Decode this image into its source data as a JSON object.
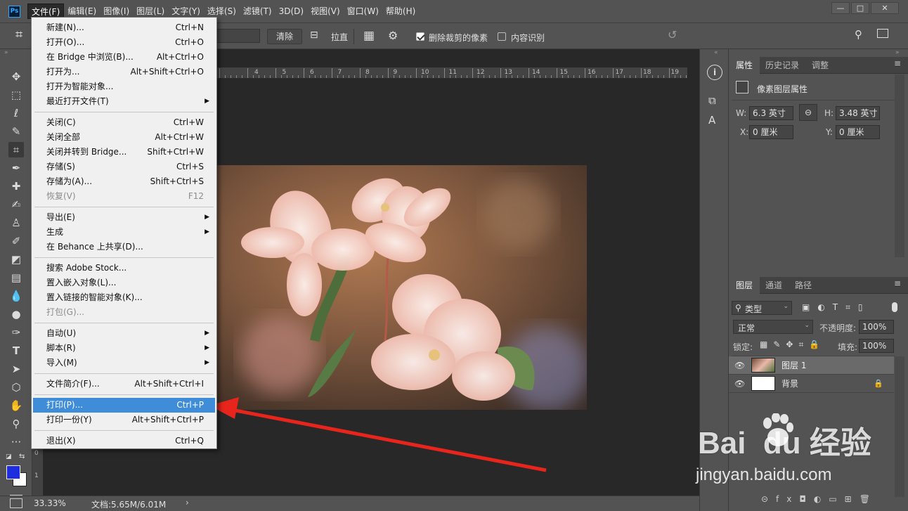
{
  "app_logo": "Ps",
  "menubar": {
    "items": [
      "文件(F)",
      "编辑(E)",
      "图像(I)",
      "图层(L)",
      "文字(Y)",
      "选择(S)",
      "滤镜(T)",
      "3D(D)",
      "视图(V)",
      "窗口(W)",
      "帮助(H)"
    ]
  },
  "window_controls": {
    "minimize": "—",
    "maximize": "□",
    "close": "✕"
  },
  "options_bar": {
    "clear_button": "清除",
    "straighten_label": "拉直",
    "delete_cropped_label": "删除裁剪的像素",
    "content_aware_label": "内容识别"
  },
  "ruler": {
    "h_ticks": [
      "4",
      "5",
      "6",
      "7",
      "8",
      "9",
      "10",
      "11",
      "12",
      "13",
      "14",
      "15",
      "16",
      "17",
      "18",
      "19"
    ],
    "v_ticks": [
      "0",
      "1"
    ]
  },
  "file_menu": {
    "groups": [
      [
        {
          "label": "新建(N)...",
          "shortcut": "Ctrl+N"
        },
        {
          "label": "打开(O)...",
          "shortcut": "Ctrl+O"
        },
        {
          "label": "在 Bridge 中浏览(B)...",
          "shortcut": "Alt+Ctrl+O"
        },
        {
          "label": "打开为...",
          "shortcut": "Alt+Shift+Ctrl+O"
        },
        {
          "label": "打开为智能对象...",
          "shortcut": ""
        },
        {
          "label": "最近打开文件(T)",
          "shortcut": "",
          "submenu": true
        }
      ],
      [
        {
          "label": "关闭(C)",
          "shortcut": "Ctrl+W"
        },
        {
          "label": "关闭全部",
          "shortcut": "Alt+Ctrl+W"
        },
        {
          "label": "关闭并转到 Bridge...",
          "shortcut": "Shift+Ctrl+W"
        },
        {
          "label": "存储(S)",
          "shortcut": "Ctrl+S"
        },
        {
          "label": "存储为(A)...",
          "shortcut": "Shift+Ctrl+S"
        },
        {
          "label": "恢复(V)",
          "shortcut": "F12",
          "disabled": true
        }
      ],
      [
        {
          "label": "导出(E)",
          "shortcut": "",
          "submenu": true
        },
        {
          "label": "生成",
          "shortcut": "",
          "submenu": true
        },
        {
          "label": "在 Behance 上共享(D)...",
          "shortcut": ""
        }
      ],
      [
        {
          "label": "搜索 Adobe Stock...",
          "shortcut": ""
        },
        {
          "label": "置入嵌入对象(L)...",
          "shortcut": ""
        },
        {
          "label": "置入链接的智能对象(K)...",
          "shortcut": ""
        },
        {
          "label": "打包(G)...",
          "shortcut": "",
          "disabled": true
        }
      ],
      [
        {
          "label": "自动(U)",
          "shortcut": "",
          "submenu": true
        },
        {
          "label": "脚本(R)",
          "shortcut": "",
          "submenu": true
        },
        {
          "label": "导入(M)",
          "shortcut": "",
          "submenu": true
        }
      ],
      [
        {
          "label": "文件简介(F)...",
          "shortcut": "Alt+Shift+Ctrl+I"
        }
      ],
      [
        {
          "label": "打印(P)...",
          "shortcut": "Ctrl+P",
          "highlighted": true
        },
        {
          "label": "打印一份(Y)",
          "shortcut": "Alt+Shift+Ctrl+P"
        }
      ],
      [
        {
          "label": "退出(X)",
          "shortcut": "Ctrl+Q"
        }
      ]
    ]
  },
  "properties_panel": {
    "tabs": [
      "属性",
      "历史记录",
      "调整"
    ],
    "header": "像素图层属性",
    "w_label": "W:",
    "w_value": "6.3 英寸",
    "h_label": "H:",
    "h_value": "3.48 英寸",
    "x_label": "X:",
    "x_value": "0 厘米",
    "y_label": "Y:",
    "y_value": "0 厘米"
  },
  "layers_panel": {
    "tabs": [
      "图层",
      "通道",
      "路径"
    ],
    "filter_kind": "类型",
    "blend_mode": "正常",
    "opacity_label": "不透明度:",
    "opacity_value": "100%",
    "lock_label": "锁定:",
    "fill_label": "填充:",
    "fill_value": "100%",
    "layers": [
      {
        "name": "图层 1",
        "selected": true
      },
      {
        "name": "背景",
        "locked": true
      }
    ]
  },
  "status_bar": {
    "zoom": "33.33%",
    "doc_info": "文档:5.65M/6.01M"
  },
  "watermark": {
    "logo_text": "Bai  du 经验",
    "url": "jingyan.baidu.com"
  },
  "colors": {
    "ui_bg": "#535353",
    "canvas_bg": "#282828",
    "menu_highlight": "#3f8cd8",
    "arrow": "#e8251c",
    "foreground_swatch": "#1e2de0",
    "background_swatch": "#ffffff"
  }
}
